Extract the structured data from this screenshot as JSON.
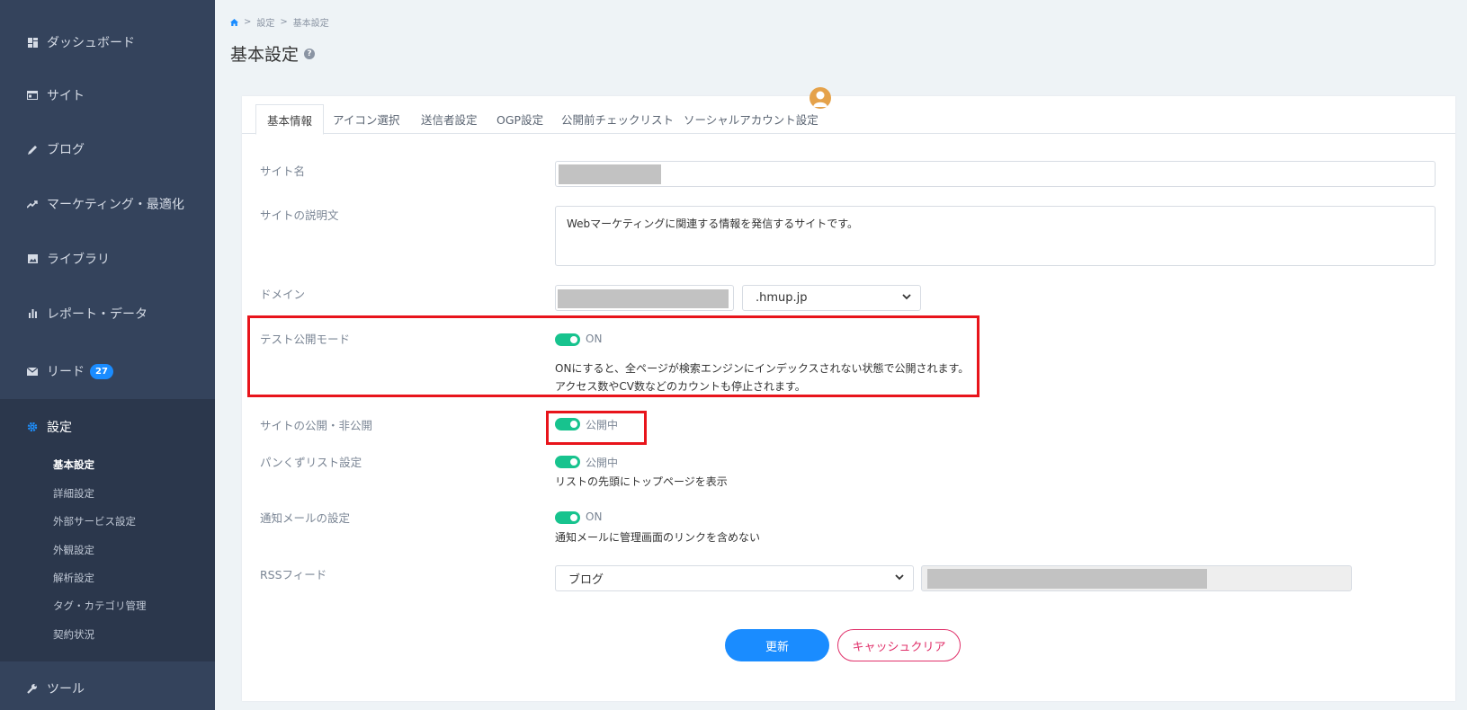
{
  "sidebar": {
    "items": [
      {
        "label": "ダッシュボード",
        "icon": "dashboard-icon"
      },
      {
        "label": "サイト",
        "icon": "site-icon"
      },
      {
        "label": "ブログ",
        "icon": "pencil-icon"
      },
      {
        "label": "マーケティング・最適化",
        "icon": "trend-icon"
      },
      {
        "label": "ライブラリ",
        "icon": "image-icon"
      },
      {
        "label": "レポート・データ",
        "icon": "bar-chart-icon"
      },
      {
        "label": "リード",
        "icon": "mail-icon",
        "badge": "27"
      },
      {
        "label": "設定",
        "icon": "gear-icon"
      },
      {
        "label": "ツール",
        "icon": "wrench-icon"
      }
    ],
    "sub_items": [
      "基本設定",
      "詳細設定",
      "外部サービス設定",
      "外観設定",
      "解析設定",
      "タグ・カテゴリ管理",
      "契約状況"
    ]
  },
  "breadcrumb": {
    "sep": ">",
    "level1": "設定",
    "level2": "基本設定"
  },
  "page": {
    "title": "基本設定",
    "help": "?"
  },
  "tabs": [
    "基本情報",
    "アイコン選択",
    "送信者設定",
    "OGP設定",
    "公開前チェックリスト",
    "ソーシャルアカウント設定"
  ],
  "form": {
    "site_name_label": "サイト名",
    "description_label": "サイトの説明文",
    "description_value": "Webマーケティングに関連する情報を発信するサイトです。",
    "domain_label": "ドメイン",
    "domain_suffix": ".hmup.jp",
    "test_mode_label": "テスト公開モード",
    "test_mode_state": "ON",
    "test_mode_desc1": "ONにすると、全ページが検索エンジンにインデックスされない状態で公開されます。",
    "test_mode_desc2": "アクセス数やCV数などのカウントも停止されます。",
    "publish_label": "サイトの公開・非公開",
    "publish_state": "公開中",
    "breadcrumb_label": "パンくずリスト設定",
    "breadcrumb_state": "公開中",
    "breadcrumb_desc": "リストの先頭にトップページを表示",
    "notify_label": "通知メールの設定",
    "notify_state": "ON",
    "notify_desc": "通知メールに管理画面のリンクを含めない",
    "rss_label": "RSSフィード",
    "rss_value": "ブログ"
  },
  "buttons": {
    "update": "更新",
    "clear_cache": "キャッシュクリア"
  },
  "colors": {
    "sidebar": "#34435c",
    "accent": "#1a8cff",
    "toggle": "#17c38e",
    "highlight": "#e8141b",
    "danger": "#e0306a"
  }
}
